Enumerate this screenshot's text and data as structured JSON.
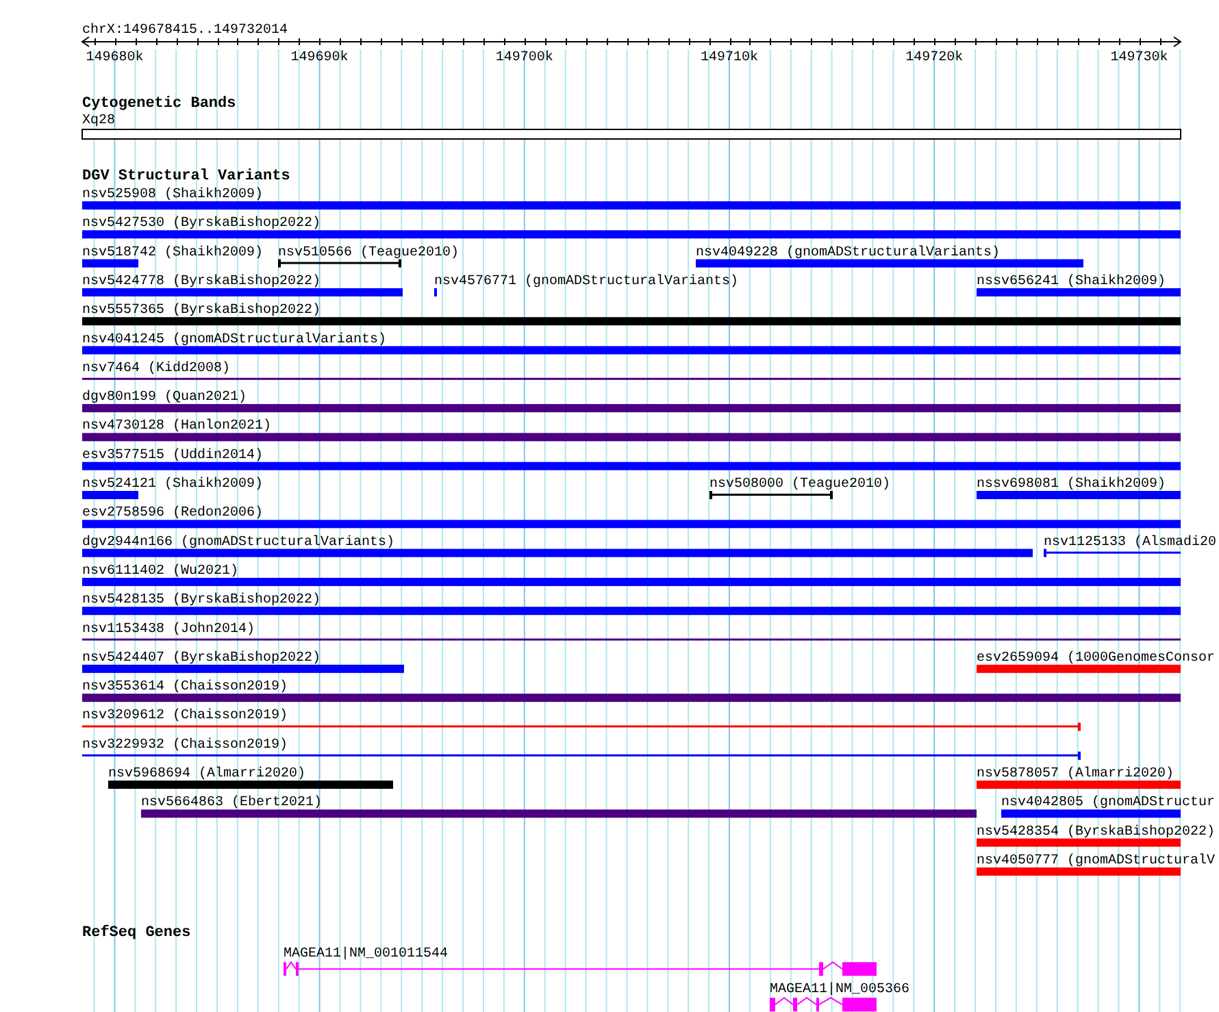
{
  "view": {
    "location": "chrX:149678415..149732014"
  },
  "ruler": {
    "ticks": [
      {
        "label": "149680k"
      },
      {
        "label": "149690k"
      },
      {
        "label": "149700k"
      },
      {
        "label": "149710k"
      },
      {
        "label": "149720k"
      },
      {
        "label": "149730k"
      }
    ]
  },
  "tracks": [
    {
      "kind": "bands",
      "title": "Cytogenetic Bands",
      "bands": [
        {
          "name": "Xq28"
        }
      ]
    },
    {
      "kind": "variants",
      "title": "DGV Structural Variants",
      "rows": [
        [
          {
            "label": "nsv525908 (Shaikh2009)",
            "kind": "bar",
            "color": "#0000ff"
          }
        ],
        [
          {
            "label": "nsv5427530 (ByrskaBishop2022)",
            "kind": "bar",
            "color": "#0000ff"
          }
        ],
        [
          {
            "label": "nsv518742 (Shaikh2009)",
            "kind": "bar",
            "color": "#0000ff"
          },
          {
            "label": "nsv510566 (Teague2010)",
            "kind": "line",
            "color": "#000000"
          },
          {
            "label": "nsv4049228 (gnomADStructuralVariants)",
            "kind": "bar",
            "color": "#0000ff"
          }
        ],
        [
          {
            "label": "nsv5424778 (ByrskaBishop2022)",
            "kind": "bar",
            "color": "#0000ff"
          },
          {
            "label": "nsv4576771 (gnomADStructuralVariants)",
            "kind": "bar",
            "color": "#0000ff"
          },
          {
            "label": "nssv656241 (Shaikh2009)",
            "kind": "bar",
            "color": "#0000ff"
          }
        ],
        [
          {
            "label": "nsv5557365 (ByrskaBishop2022)",
            "kind": "bar",
            "color": "#000000"
          }
        ],
        [
          {
            "label": "nsv4041245 (gnomADStructuralVariants)",
            "kind": "bar",
            "color": "#0000ff"
          }
        ],
        [
          {
            "label": "nsv7464 (Kidd2008)",
            "kind": "line",
            "color": "#4b0082"
          }
        ],
        [
          {
            "label": "dgv80n199 (Quan2021)",
            "kind": "bar",
            "color": "#4b0082"
          }
        ],
        [
          {
            "label": "nsv4730128 (Hanlon2021)",
            "kind": "bar",
            "color": "#4b0082"
          }
        ],
        [
          {
            "label": "esv3577515 (Uddin2014)",
            "kind": "bar",
            "color": "#0000ff"
          }
        ],
        [
          {
            "label": "nsv524121 (Shaikh2009)",
            "kind": "bar",
            "color": "#0000ff"
          },
          {
            "label": "nsv508000 (Teague2010)",
            "kind": "line",
            "color": "#000000"
          },
          {
            "label": "nssv698081 (Shaikh2009)",
            "kind": "bar",
            "color": "#0000ff"
          }
        ],
        [
          {
            "label": "esv2758596 (Redon2006)",
            "kind": "bar",
            "color": "#0000ff"
          }
        ],
        [
          {
            "label": "dgv2944n166 (gnomADStructuralVariants)",
            "kind": "bar",
            "color": "#0000ff"
          },
          {
            "label": "nsv1125133 (Alsmadi20",
            "kind": "line",
            "color": "#0000ff"
          }
        ],
        [
          {
            "label": "nsv6111402 (Wu2021)",
            "kind": "bar",
            "color": "#0000ff"
          }
        ],
        [
          {
            "label": "nsv5428135 (ByrskaBishop2022)",
            "kind": "bar",
            "color": "#0000ff"
          }
        ],
        [
          {
            "label": "nsv1153438 (John2014)",
            "kind": "line",
            "color": "#4b0082"
          }
        ],
        [
          {
            "label": "nsv5424407 (ByrskaBishop2022)",
            "kind": "bar",
            "color": "#0000ff"
          },
          {
            "label": "esv2659094 (1000GenomesConsor",
            "kind": "bar",
            "color": "#ff0000"
          }
        ],
        [
          {
            "label": "nsv3553614 (Chaisson2019)",
            "kind": "bar",
            "color": "#4b0082"
          }
        ],
        [
          {
            "label": "nsv3209612 (Chaisson2019)",
            "kind": "line",
            "color": "#ff0000"
          }
        ],
        [
          {
            "label": "nsv3229932 (Chaisson2019)",
            "kind": "line",
            "color": "#0000ff"
          }
        ],
        [
          {
            "label": "nsv5968694 (Almarri2020)",
            "kind": "bar",
            "color": "#000000"
          },
          {
            "label": "nsv5878057 (Almarri2020)",
            "kind": "bar",
            "color": "#ff0000"
          }
        ],
        [
          {
            "label": "nsv5664863 (Ebert2021)",
            "kind": "bar",
            "color": "#4b0082"
          },
          {
            "label": "nsv4042805 (gnomADStructur",
            "kind": "bar",
            "color": "#0000ff"
          }
        ],
        [
          {
            "label": "nsv5428354 (ByrskaBishop2022)",
            "kind": "bar",
            "color": "#ff0000"
          }
        ],
        [
          {
            "label": "nsv4050777 (gnomADStructuralV",
            "kind": "bar",
            "color": "#ff0000"
          }
        ]
      ]
    },
    {
      "kind": "genes",
      "title": "RefSeq Genes",
      "transcripts": [
        {
          "label": "MAGEA11|NM_001011544"
        },
        {
          "label": "MAGEA11|NM_005366"
        }
      ]
    }
  ]
}
